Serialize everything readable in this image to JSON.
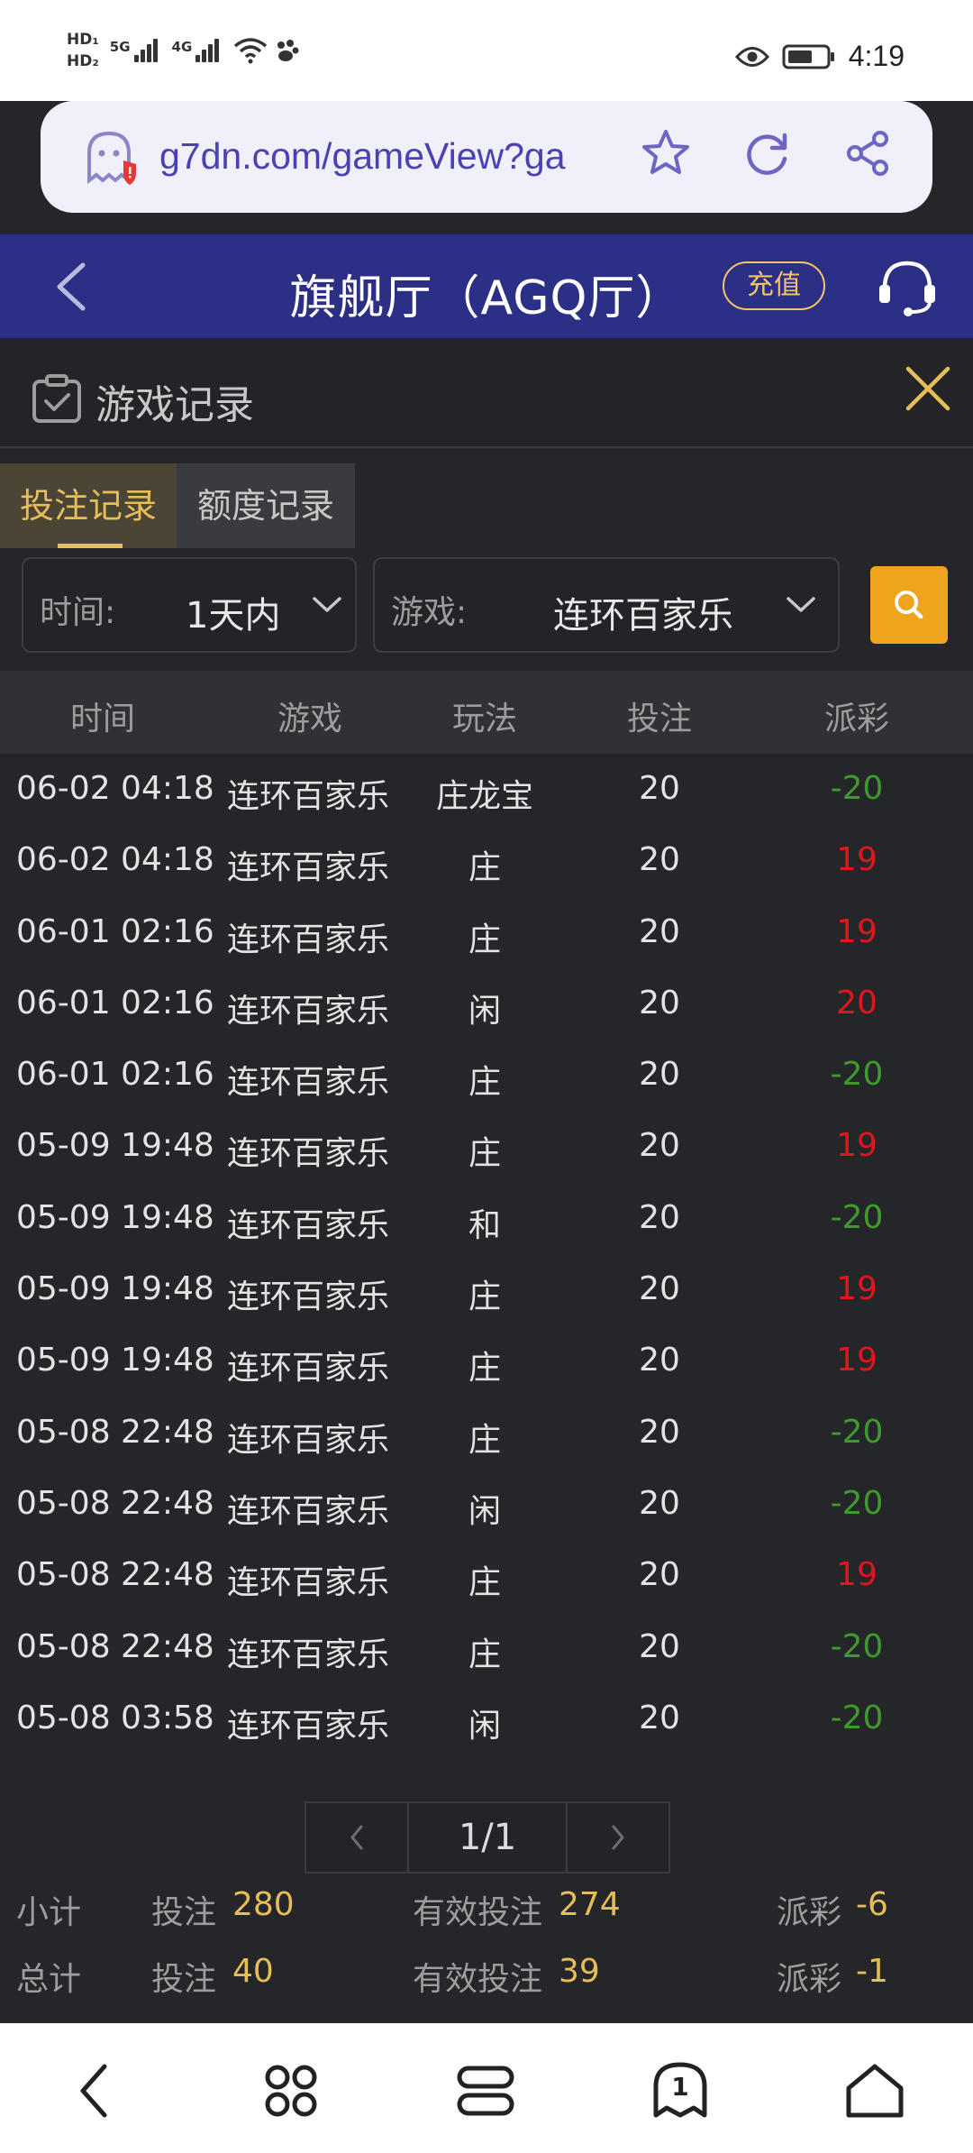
{
  "status_bar": {
    "hd1": "HD₁",
    "hd2": "HD₂",
    "net1": "5G",
    "net2": "4G",
    "time": "4:19"
  },
  "browser": {
    "url": "g7dn.com/gameView?ga"
  },
  "header": {
    "title": "旗舰厅（AGQ厅）",
    "recharge": "充值"
  },
  "panel": {
    "title": "游戏记录",
    "tabs": [
      {
        "label": "投注记录",
        "active": true
      },
      {
        "label": "额度记录",
        "active": false
      }
    ]
  },
  "filters": {
    "time_label": "时间:",
    "time_value": "1天内",
    "game_label": "游戏:",
    "game_value": "连环百家乐"
  },
  "table": {
    "columns": [
      "时间",
      "游戏",
      "玩法",
      "投注",
      "派彩"
    ],
    "rows": [
      {
        "time": "06-02 04:18",
        "game": "连环百家乐",
        "play": "庄龙宝",
        "bet": "20",
        "payout": "-20"
      },
      {
        "time": "06-02 04:18",
        "game": "连环百家乐",
        "play": "庄",
        "bet": "20",
        "payout": "19"
      },
      {
        "time": "06-01 02:16",
        "game": "连环百家乐",
        "play": "庄",
        "bet": "20",
        "payout": "19"
      },
      {
        "time": "06-01 02:16",
        "game": "连环百家乐",
        "play": "闲",
        "bet": "20",
        "payout": "20"
      },
      {
        "time": "06-01 02:16",
        "game": "连环百家乐",
        "play": "庄",
        "bet": "20",
        "payout": "-20"
      },
      {
        "time": "05-09 19:48",
        "game": "连环百家乐",
        "play": "庄",
        "bet": "20",
        "payout": "19"
      },
      {
        "time": "05-09 19:48",
        "game": "连环百家乐",
        "play": "和",
        "bet": "20",
        "payout": "-20"
      },
      {
        "time": "05-09 19:48",
        "game": "连环百家乐",
        "play": "庄",
        "bet": "20",
        "payout": "19"
      },
      {
        "time": "05-09 19:48",
        "game": "连环百家乐",
        "play": "庄",
        "bet": "20",
        "payout": "19"
      },
      {
        "time": "05-08 22:48",
        "game": "连环百家乐",
        "play": "庄",
        "bet": "20",
        "payout": "-20"
      },
      {
        "time": "05-08 22:48",
        "game": "连环百家乐",
        "play": "闲",
        "bet": "20",
        "payout": "-20"
      },
      {
        "time": "05-08 22:48",
        "game": "连环百家乐",
        "play": "庄",
        "bet": "20",
        "payout": "19"
      },
      {
        "time": "05-08 22:48",
        "game": "连环百家乐",
        "play": "庄",
        "bet": "20",
        "payout": "-20"
      },
      {
        "time": "05-08 03:58",
        "game": "连环百家乐",
        "play": "闲",
        "bet": "20",
        "payout": "-20"
      }
    ]
  },
  "pagination": {
    "prev": "‹",
    "page": "1/1",
    "next": "›"
  },
  "summary": {
    "subtotal": {
      "label": "小计",
      "bet_label": "投注",
      "bet": "280",
      "valid_label": "有效投注",
      "valid": "274",
      "payout_label": "派彩",
      "payout": "-6"
    },
    "total": {
      "label": "总计",
      "bet_label": "投注",
      "bet": "40",
      "valid_label": "有效投注",
      "valid": "39",
      "payout_label": "派彩",
      "payout": "-1"
    }
  },
  "bottom_nav": {
    "tab_count": "1"
  },
  "colors": {
    "header_bg": "#2c2f86",
    "accent_gold": "#e7bd57",
    "search_orange": "#eea51d",
    "loss_green": "#3e9a2c",
    "win_red": "#e0161d"
  }
}
